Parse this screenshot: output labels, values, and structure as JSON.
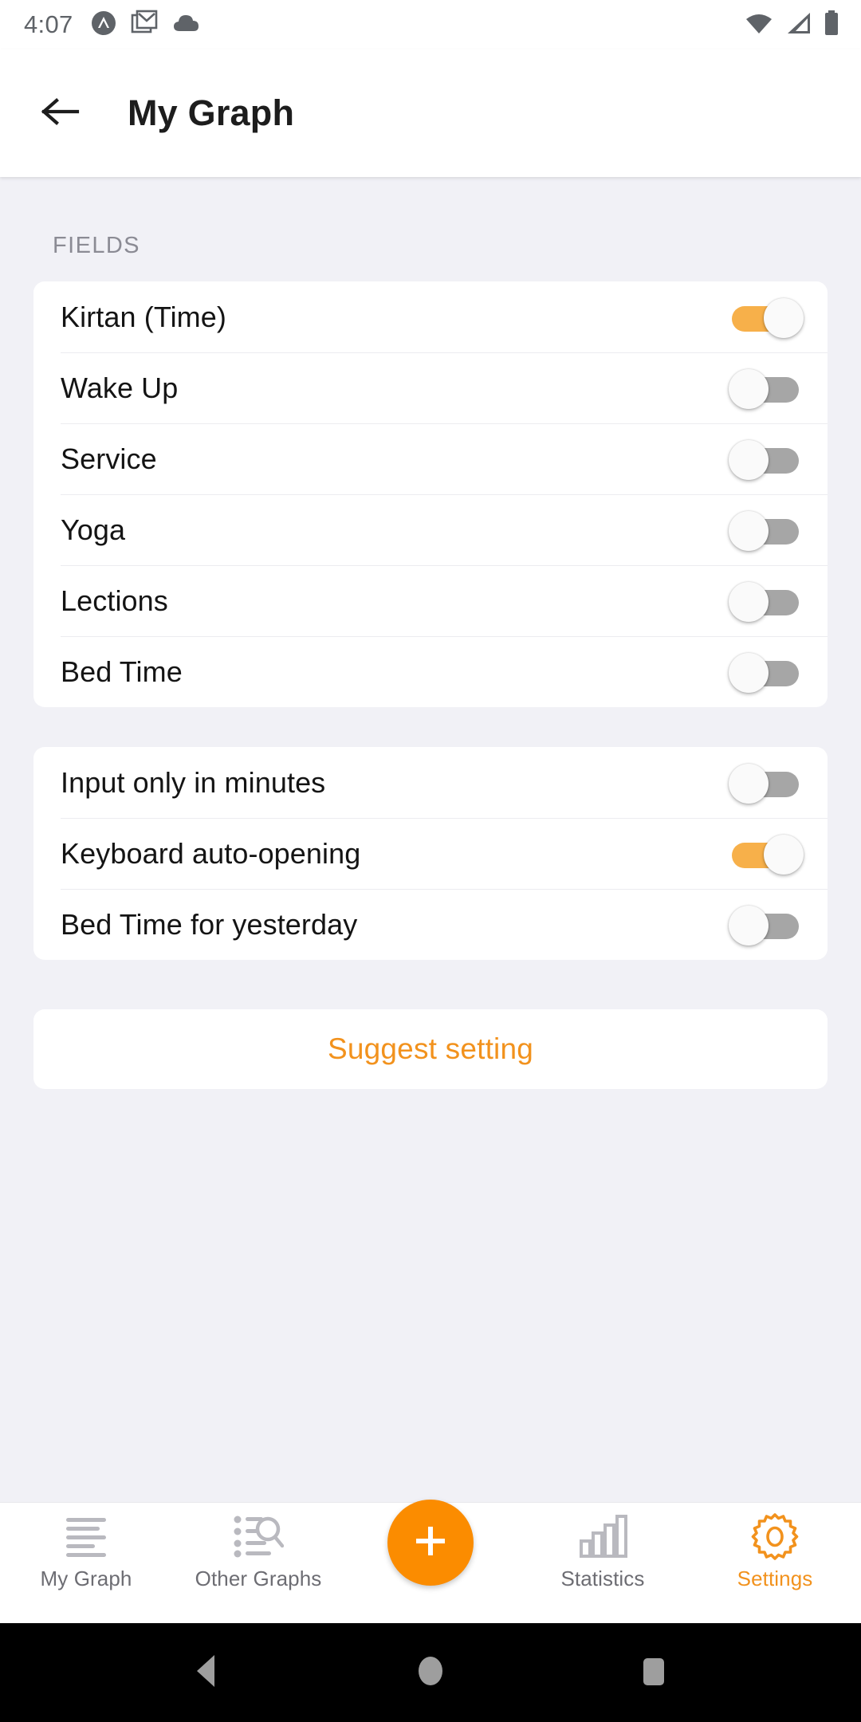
{
  "status_bar": {
    "time": "4:07",
    "left_icons": [
      "circle-caret-badge-icon",
      "gmail-icon",
      "cloud-icon"
    ],
    "right_icons": [
      "wifi-icon",
      "cellular-signal-icon",
      "battery-icon"
    ]
  },
  "app_bar": {
    "back_icon": "arrow-left-icon",
    "title": "My Graph"
  },
  "colors": {
    "accent": "#f2921d",
    "fab": "#fb8c00",
    "switch_on_track": "#f7b04a",
    "switch_off_track": "#a6a6a6",
    "background": "#f1f1f6",
    "card": "#ffffff"
  },
  "fields_section": {
    "label": "FIELDS",
    "rows": [
      {
        "label": "Kirtan (Time)",
        "enabled": true
      },
      {
        "label": "Wake Up",
        "enabled": false
      },
      {
        "label": "Service",
        "enabled": false
      },
      {
        "label": "Yoga",
        "enabled": false
      },
      {
        "label": "Lections",
        "enabled": false
      },
      {
        "label": "Bed Time",
        "enabled": false
      }
    ]
  },
  "options_section": {
    "rows": [
      {
        "label": "Input only in minutes",
        "enabled": false
      },
      {
        "label": "Keyboard auto-opening",
        "enabled": true
      },
      {
        "label": "Bed Time for yesterday",
        "enabled": false
      }
    ]
  },
  "suggest_button": {
    "label": "Suggest setting"
  },
  "bottom_nav": {
    "items": [
      {
        "label": "My Graph",
        "icon": "lines-list-icon",
        "active": false
      },
      {
        "label": "Other Graphs",
        "icon": "list-search-icon",
        "active": false
      },
      {
        "label": "Statistics",
        "icon": "bar-chart-icon",
        "active": false
      },
      {
        "label": "Settings",
        "icon": "gear-icon",
        "active": true
      }
    ],
    "fab": {
      "icon": "plus-icon"
    }
  },
  "android_nav": {
    "back": "back-triangle-icon",
    "home": "home-circle-icon",
    "recents": "recents-square-icon"
  }
}
